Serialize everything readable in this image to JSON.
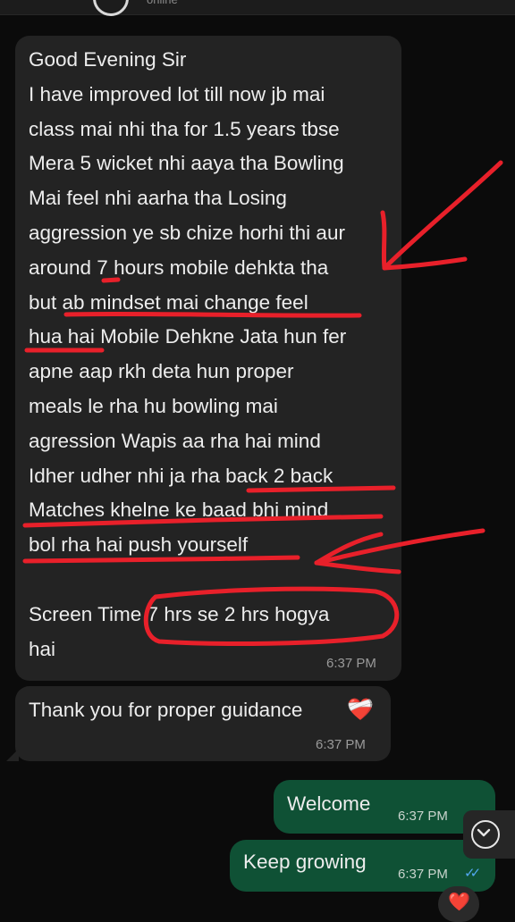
{
  "header": {
    "status": "online"
  },
  "messages": {
    "m1": {
      "text": "Good Evening Sir\nI have improved lot till now jb mai\nclass mai nhi tha for 1.5 years tbse\nMera 5 wicket nhi aaya tha Bowling\nMai feel nhi aarha tha Losing\naggression ye sb chize horhi thi aur\naround 7 hours mobile dehkta tha\nbut ab mindset mai change feel\nhua hai Mobile Dehkne Jata hun fer\napne aap rkh deta hun proper\nmeals le rha hu bowling mai\nagression Wapis aa rha hai mind\nIdher udher nhi ja rha back 2 back\nMatches khelne ke baad bhi mind\nbol rha hai push yourself\n\nScreen Time 7 hrs se 2 hrs hogya\nhai",
      "time": "6:37 PM"
    },
    "m2": {
      "text": "Thank you for proper guidance",
      "emoji": "❤️‍🩹",
      "time": "6:37 PM"
    },
    "m3": {
      "text": "Welcome",
      "time": "6:37 PM"
    },
    "m4": {
      "text": "Keep growing",
      "time": "6:37 PM",
      "ticks": "✓✓"
    },
    "reaction": "❤️"
  },
  "colors": {
    "incoming_bubble": "#232323",
    "outgoing_bubble": "#0f5135",
    "annotation_red": "#e8202a",
    "read_ticks": "#53a7f0"
  }
}
